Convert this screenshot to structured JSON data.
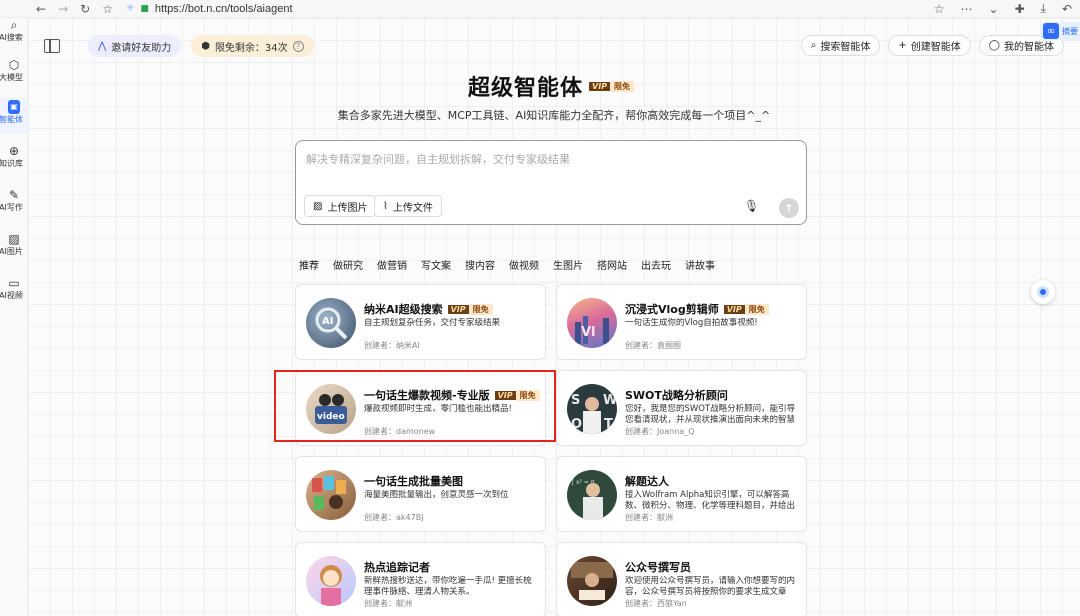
{
  "browser": {
    "url": "https://bot.n.cn/tools/aiagent",
    "nav_icons": [
      "back-icon",
      "forward-icon",
      "reload-icon",
      "bookmark-star-icon"
    ]
  },
  "rail": [
    {
      "label": "AI搜索",
      "icon": "search-icon"
    },
    {
      "label": "大模型",
      "icon": "cube-icon"
    },
    {
      "label": "智能体",
      "icon": "bot-icon",
      "active": true
    },
    {
      "label": "知识库",
      "icon": "plus-circle-icon"
    },
    {
      "label": "AI写作",
      "icon": "pen-icon"
    },
    {
      "label": "AI图片",
      "icon": "image-icon"
    },
    {
      "label": "AI视频",
      "icon": "video-icon"
    }
  ],
  "topbar": {
    "invite_label": "邀请好友助力",
    "quota_label": "限免剩余：34次",
    "search_agent": "搜索智能体",
    "create_agent": "创建智能体",
    "my_agent": "我的智能体"
  },
  "extension_label": "摘要",
  "hero": {
    "title": "超级智能体",
    "vip": "VIP",
    "free": "限免",
    "subtitle": "集合多家先进大模型、MCP工具链、AI知识库能力全配齐，帮你高效完成每一个项目^_^"
  },
  "composer": {
    "placeholder": "解决专精深复杂问题，自主规划拆解，交付专家级结果",
    "upload_image": "上传图片",
    "upload_file": "上传文件"
  },
  "tabs": [
    "推荐",
    "做研究",
    "做营销",
    "写文案",
    "搜内容",
    "做视频",
    "生图片",
    "搭网站",
    "出去玩",
    "讲故事"
  ],
  "cards": [
    {
      "name": "纳米AI超级搜索",
      "badge": true,
      "desc": "自主规划复杂任务，交付专家级结果",
      "creator": "创建者：纳米AI",
      "avatar": "ai"
    },
    {
      "name": "沉浸式Vlog剪辑师",
      "badge": true,
      "desc": "一句话生成你的Vlog自拍故事视频!",
      "creator": "创建者：袁囿囿",
      "avatar": "vlog"
    },
    {
      "name": "一句话生爆款视频-专业版",
      "badge": true,
      "desc": "爆款视频即时生成，零门槛也能出精品!",
      "creator": "创建者：damonew",
      "avatar": "video"
    },
    {
      "name": "SWOT战略分析顾问",
      "badge": false,
      "desc": "您好，我是您的SWOT战略分析顾问，能引导您看清现状，并从现状推演出面向未来的智慧战略。",
      "creator": "创建者：Joanna_Q",
      "avatar": "swot"
    },
    {
      "name": "一句话生成批量美图",
      "badge": false,
      "desc": "海量美图批量输出，创意灵感一次到位",
      "creator": "创建者：ak47BJ",
      "avatar": "photo"
    },
    {
      "name": "解题达人",
      "badge": false,
      "desc": "接入Wolfram Alpha知识引擎，可以解答高数、微积分、物理、化学等理科题目，并给出详细的解…",
      "creator": "创建者：献洲",
      "avatar": "teacher"
    },
    {
      "name": "热点追踪记者",
      "badge": false,
      "desc": "新鲜热搜秒送达，带你吃遍一手瓜! 更擅长梳理事件脉络、理清人物关系。",
      "creator": "创建者：献洲",
      "avatar": "reporter"
    },
    {
      "name": "公众号撰写员",
      "badge": false,
      "desc": "欢迎使用公众号撰写员，请输入你想要写的内容，公众号撰写员将按照你的要求生成文章",
      "creator": "创建者：西狼Yan",
      "avatar": "writer"
    }
  ],
  "colors": {
    "accent": "#2f6bff",
    "highlight": "#e1251b",
    "vip_dark": "#6b3f16",
    "vip_light": "#fce7c8"
  }
}
